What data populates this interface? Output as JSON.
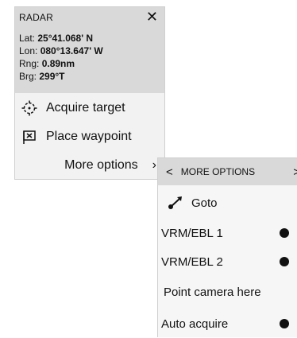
{
  "main_panel": {
    "title": "RADAR",
    "close_glyph": "✕",
    "info": {
      "lat_label": "Lat:",
      "lat_value": "25°41.068' N",
      "lon_label": "Lon:",
      "lon_value": "080°13.647' W",
      "rng_label": "Rng:",
      "rng_value": "0.89nm",
      "brg_label": "Brg:",
      "brg_value": "299°T"
    },
    "items": [
      {
        "label": "Acquire target",
        "icon": "target-icon"
      },
      {
        "label": "Place waypoint",
        "icon": "waypoint-flag-icon"
      },
      {
        "label": "More options",
        "icon": "chevron-right-icon"
      }
    ]
  },
  "sub_panel": {
    "title": "MORE OPTIONS",
    "back_glyph": "<",
    "forward_glyph": ">",
    "items": [
      {
        "label": "Goto",
        "icon": "goto-icon",
        "toggle": false
      },
      {
        "label": "VRM/EBL 1",
        "toggle": true
      },
      {
        "label": "VRM/EBL 2",
        "toggle": true
      },
      {
        "label": "Point camera here",
        "toggle": false
      },
      {
        "label": "Auto acquire",
        "toggle": true
      }
    ]
  }
}
